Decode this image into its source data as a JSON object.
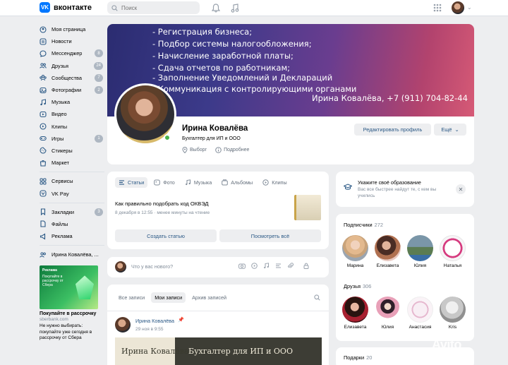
{
  "app": {
    "name": "вконтакте"
  },
  "search": {
    "placeholder": "Поиск"
  },
  "sidebar": {
    "items": [
      {
        "label": "Моя страница",
        "count": ""
      },
      {
        "label": "Новости",
        "count": ""
      },
      {
        "label": "Мессенджер",
        "count": "8"
      },
      {
        "label": "Друзья",
        "count": "24"
      },
      {
        "label": "Сообщества",
        "count": "7"
      },
      {
        "label": "Фотографии",
        "count": "2"
      },
      {
        "label": "Музыка",
        "count": ""
      },
      {
        "label": "Видео",
        "count": ""
      },
      {
        "label": "Клипы",
        "count": ""
      },
      {
        "label": "Игры",
        "count": "1"
      },
      {
        "label": "Стикеры",
        "count": ""
      },
      {
        "label": "Маркет",
        "count": ""
      }
    ],
    "items2": [
      {
        "label": "Сервисы",
        "count": ""
      },
      {
        "label": "VK Pay",
        "count": ""
      }
    ],
    "items3": [
      {
        "label": "Закладки",
        "count": "3"
      },
      {
        "label": "Файлы",
        "count": ""
      },
      {
        "label": "Реклама",
        "count": ""
      }
    ],
    "group_label": "Ирина Ковалёва, ...",
    "ad": {
      "image_text": "Покупайте в рассрочку от Сбера",
      "image_brand": "Реклама",
      "title": "Покупайте в рассрочку",
      "domain": "sberbank.com",
      "desc": "Не нужно выбирать: покупайте уже сегодня в рассрочку от Сбера"
    }
  },
  "profile": {
    "cover_lines": [
      "- Регистрация бизнеса;",
      "- Подбор системы налогообложения;",
      "- Начисление заработной платы;",
      "- Сдача отчетов по работникам;",
      "- Заполнение Уведомлений и Деклараций",
      "- Коммуникация с контролирующими органами"
    ],
    "cover_contact": "Ирина Ковалёва, +7 (911) 704-82-44",
    "name": "Ирина Ковалёва",
    "status": "Бухгалтер для ИП и ООО",
    "location": "Выборг",
    "details": "Подробнее",
    "edit_label": "Редактировать профиль",
    "more_label": "Ещё"
  },
  "content_tabs": {
    "tabs": [
      "Статьи",
      "Фото",
      "Музыка",
      "Альбомы",
      "Клипы"
    ],
    "article_title": "Как правильно подобрать код ОКВЭД",
    "article_meta": "8 декабря в 12:55 · менее минуты на чтение",
    "create_label": "Создать статью",
    "view_all_label": "Посмотреть всё"
  },
  "post_box": {
    "placeholder": "Что у вас нового?"
  },
  "wall": {
    "tabs": [
      "Все записи",
      "Мои записи",
      "Архив записей"
    ],
    "author": "Ирина Ковалёва",
    "date": "29 ноя в 9:55",
    "image_left": "Ирина Ковалёва",
    "image_right": "Бухгалтер для ИП и ООО"
  },
  "education": {
    "title": "Укажите своё образование",
    "desc": "Вас все быстрее найдут те, с кем вы учились"
  },
  "subscribers": {
    "title": "Подписчики",
    "count": "272",
    "people": [
      "Марина",
      "Елизавета",
      "Юлия",
      "Наталья"
    ]
  },
  "friends": {
    "title": "Друзья",
    "count": "306",
    "people": [
      "Елизавета",
      "Юлия",
      "Анастасия",
      "Kris"
    ]
  },
  "gifts": {
    "title": "Подарки",
    "count": "20"
  },
  "watermark": "Avito",
  "colors": {
    "accent": "#0077ff",
    "link": "#2a5885",
    "online": "#4bb34b",
    "bg": "#edeef0"
  }
}
